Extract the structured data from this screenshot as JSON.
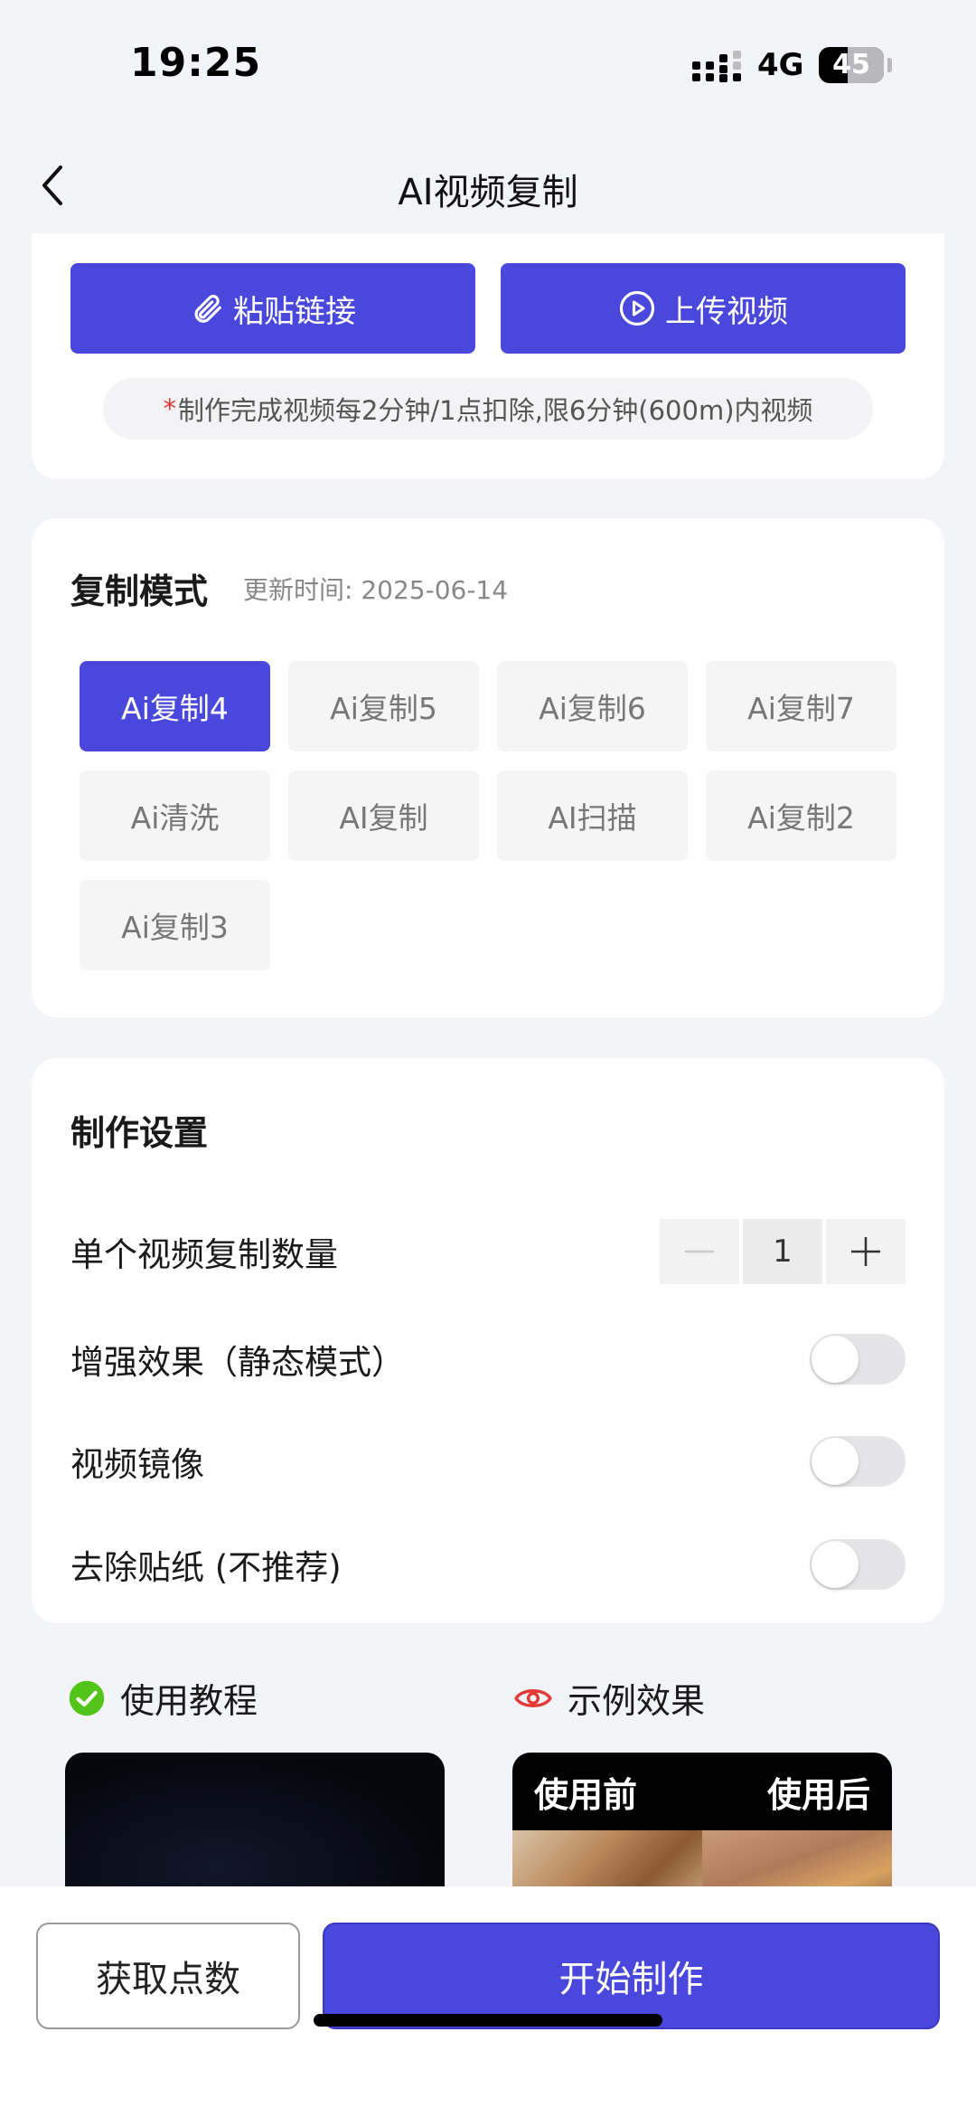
{
  "status_bar": {
    "time": "19:25",
    "network": "4G",
    "battery": "45",
    "battery_level": 0.45
  },
  "nav": {
    "title": "AI视频复制",
    "back_icon": "chevron-left-icon"
  },
  "upload": {
    "paste_label": "粘贴链接",
    "upload_label": "上传视频",
    "notice_star": "*",
    "notice": "制作完成视频每2分钟/1点扣除,限6分钟(600m)内视频"
  },
  "mode": {
    "title": "复制模式",
    "update_time": "更新时间: 2025-06-14",
    "items": [
      {
        "label": "Ai复制4",
        "active": true
      },
      {
        "label": "Ai复制5",
        "active": false
      },
      {
        "label": "Ai复制6",
        "active": false
      },
      {
        "label": "Ai复制7",
        "active": false
      },
      {
        "label": "Ai清洗",
        "active": false
      },
      {
        "label": "AI复制",
        "active": false
      },
      {
        "label": "AI扫描",
        "active": false
      },
      {
        "label": "Ai复制2",
        "active": false
      },
      {
        "label": "Ai复制3",
        "active": false
      }
    ]
  },
  "settings": {
    "title": "制作设置",
    "copy_count_label": "单个视频复制数量",
    "copy_count_value": "1",
    "enhance_label": "增强效果（静态模式）",
    "enhance_on": false,
    "mirror_label": "视频镜像",
    "mirror_on": false,
    "remove_sticker_label": "去除贴纸 (不推荐)",
    "remove_sticker_on": false
  },
  "guides": {
    "tutorial_label": "使用教程",
    "example_label": "示例效果",
    "before_label": "使用前",
    "after_label": "使用后"
  },
  "bottom": {
    "points_label": "获取点数",
    "start_label": "开始制作"
  },
  "colors": {
    "primary": "#4a47dd",
    "success": "#52c41a",
    "danger": "#e53935"
  }
}
